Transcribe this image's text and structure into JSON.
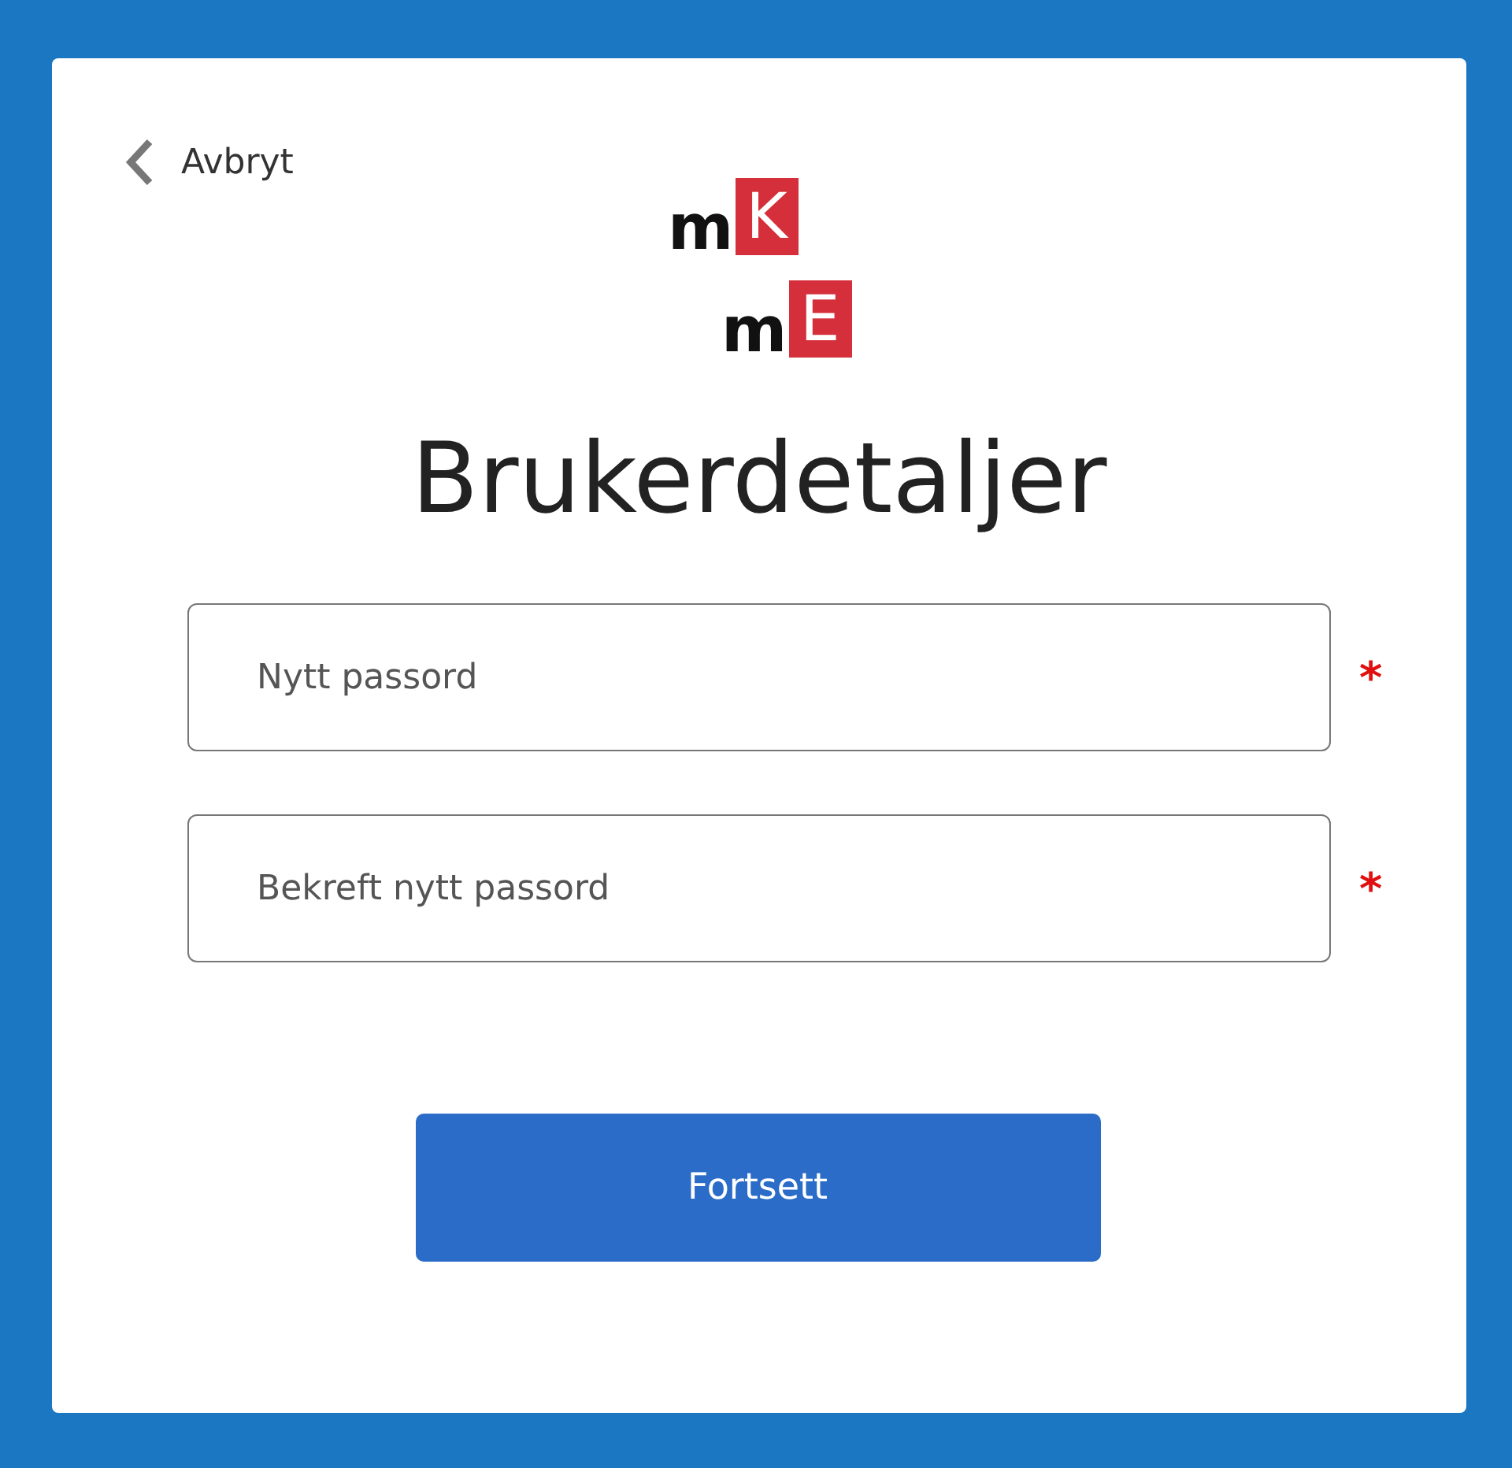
{
  "back_link": {
    "label": "Avbryt"
  },
  "logos": [
    {
      "prefix": "m",
      "letter": "K"
    },
    {
      "prefix": "m",
      "letter": "E"
    }
  ],
  "title": "Brukerdetaljer",
  "fields": [
    {
      "placeholder": "Nytt passord",
      "required_mark": "*"
    },
    {
      "placeholder": "Bekreft nytt passord",
      "required_mark": "*"
    }
  ],
  "submit_button": {
    "label": "Fortsett"
  }
}
